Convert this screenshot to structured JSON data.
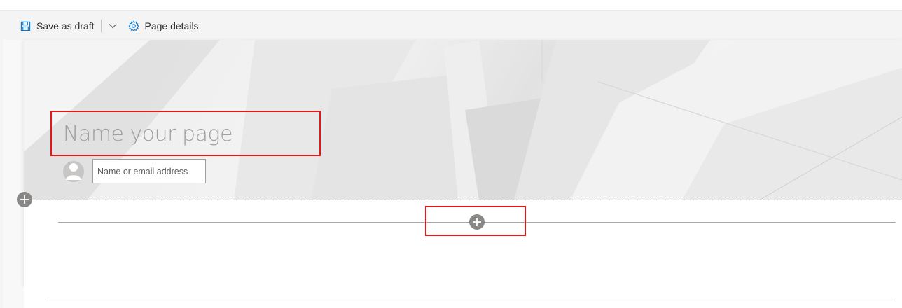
{
  "toolbar": {
    "save_label": "Save as draft",
    "page_details_label": "Page details"
  },
  "hero": {
    "title_placeholder": "Name your page",
    "author_placeholder": "Name or email address"
  },
  "colors": {
    "accent": "#0078d4",
    "highlight": "#e0191c",
    "add_button": "#8a8886"
  },
  "icons": {
    "save": "save-icon",
    "chevron": "chevron-down-icon",
    "settings": "gear-icon",
    "avatar": "person-icon",
    "add": "add-circle-icon"
  }
}
